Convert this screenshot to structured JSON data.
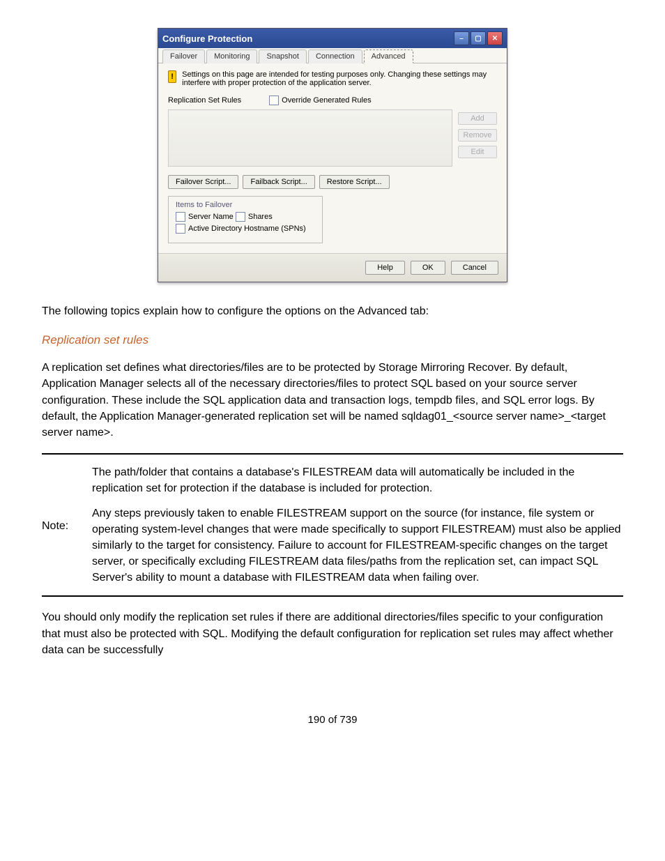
{
  "window": {
    "title": "Configure Protection",
    "tabs": [
      "Failover",
      "Monitoring",
      "Snapshot",
      "Connection",
      "Advanced"
    ],
    "active_tab": "Advanced",
    "warning_text": "Settings on this page are intended for testing purposes only.  Changing these settings may interfere with proper protection of the application server.",
    "rules_label": "Replication Set Rules",
    "override_label": "Override Generated Rules",
    "rule_buttons": {
      "add": "Add",
      "remove": "Remove",
      "edit": "Edit"
    },
    "script_buttons": {
      "failover": "Failover Script...",
      "failback": "Failback Script...",
      "restore": "Restore Script..."
    },
    "items_legend": "Items to Failover",
    "items": [
      "Server Name",
      "Shares",
      "Active Directory Hostname (SPNs)"
    ],
    "footer": {
      "help": "Help",
      "ok": "OK",
      "cancel": "Cancel"
    }
  },
  "doc": {
    "intro_line": "The following topics explain how to configure the options on the Advanced tab:",
    "heading1": "Replication set rules",
    "para1": "A replication set defines what directories/files are to be protected by Storage Mirroring Recover. By default, Application Manager selects all of the necessary directories/files to protect SQL based on your source server configuration. These include the SQL application data and transaction logs, tempdb files, and SQL error logs. By default, the Application Manager-generated replication set will be named sqldag01_<source server name>_<target server name>.",
    "note_label": "Note:",
    "note_p1": "The path/folder that contains a database's FILESTREAM data will automatically be included in the replication set for protection if the database is included for protection.",
    "note_p2": "Any steps previously taken to enable FILESTREAM support on the source (for instance, file system or operating system-level changes that were made specifically to support FILESTREAM) must also be applied similarly to the target for consistency. Failure to account for FILESTREAM-specific changes on the target server, or specifically excluding FILESTREAM data files/paths from the replication set, can impact SQL Server's ability to mount a database with FILESTREAM data when failing over.",
    "para2": "You should only modify the replication set rules if there are additional directories/files specific to your configuration that must also be protected with SQL. Modifying the default configuration for replication set rules may affect whether data can be successfully",
    "page_num": "190 of 739"
  }
}
